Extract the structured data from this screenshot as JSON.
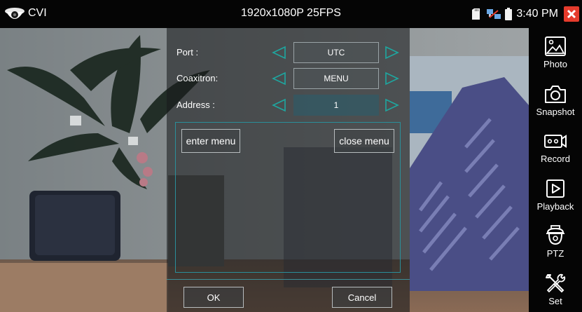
{
  "status_bar": {
    "app_name": "CVI",
    "resolution": "1920x1080P 25FPS",
    "time": "3:40 PM",
    "icons": [
      "camera-logo-icon",
      "sd-card-icon",
      "network-icon",
      "battery-icon",
      "close-icon"
    ],
    "close_color": "#e53b2c"
  },
  "dialog": {
    "rows": [
      {
        "label": "Port :",
        "value": "UTC"
      },
      {
        "label": "Coaxitron:",
        "value": "MENU"
      },
      {
        "label": "Address :",
        "value": "1"
      }
    ],
    "enter_menu": "enter menu",
    "close_menu": "close menu",
    "ok": "OK",
    "cancel": "Cancel",
    "accent": "#2a8f9a"
  },
  "sidebar": {
    "items": [
      {
        "label": "Photo",
        "icon": "photo-icon"
      },
      {
        "label": "Snapshot",
        "icon": "camera-icon"
      },
      {
        "label": "Record",
        "icon": "video-record-icon"
      },
      {
        "label": "Playback",
        "icon": "playback-icon"
      },
      {
        "label": "PTZ",
        "icon": "ptz-dome-icon"
      },
      {
        "label": "Set",
        "icon": "tools-icon"
      }
    ]
  }
}
